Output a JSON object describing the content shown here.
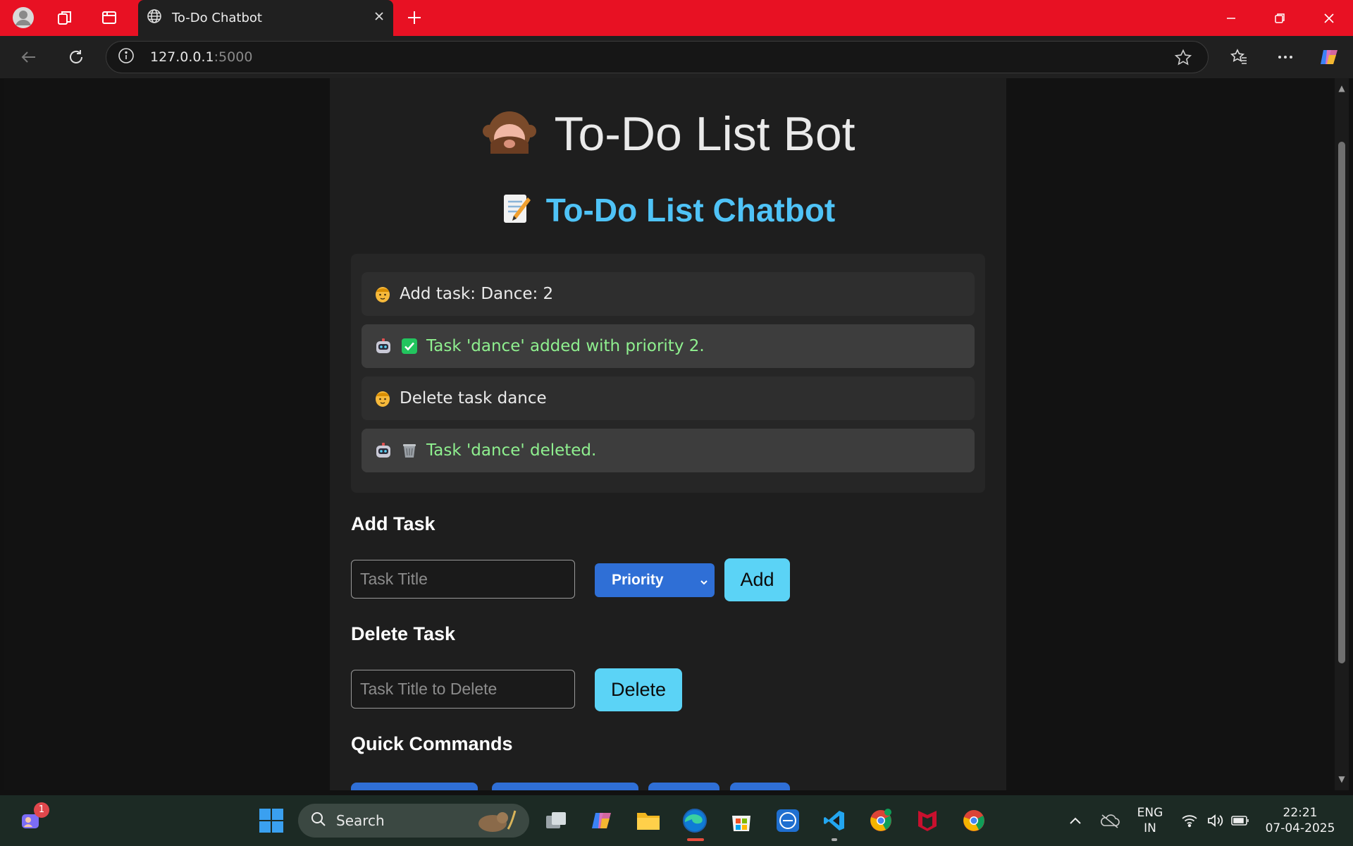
{
  "browser": {
    "tab_title": "To-Do Chatbot",
    "url_host": "127.0.0.1",
    "url_port": ":5000"
  },
  "page": {
    "title": "To-Do List Bot",
    "subtitle": "To-Do List Chatbot",
    "accent_color": "#4fc3f7",
    "bot_text_color": "#8ff08f",
    "chat": [
      {
        "role": "user",
        "text": "Add task: Dance: 2",
        "icon": "user-face-icon"
      },
      {
        "role": "bot",
        "text": "Task 'dance' added with priority 2.",
        "icon": "robot-icon",
        "status_icon": "check-mark-icon"
      },
      {
        "role": "user",
        "text": "Delete task dance",
        "icon": "user-face-icon"
      },
      {
        "role": "bot",
        "text": "Task 'dance' deleted.",
        "icon": "robot-icon",
        "status_icon": "wastebasket-icon"
      }
    ],
    "add_task": {
      "heading": "Add Task",
      "placeholder": "Task Title",
      "priority_label": "Priority",
      "button": "Add"
    },
    "delete_task": {
      "heading": "Delete Task",
      "placeholder": "Task Title to Delete",
      "button": "Delete"
    },
    "quick_commands": {
      "heading": "Quick Commands"
    }
  },
  "taskbar": {
    "search_label": "Search",
    "notification_count": "1",
    "lang_line1": "ENG",
    "lang_line2": "IN",
    "time": "22:21",
    "date": "07-04-2025"
  }
}
